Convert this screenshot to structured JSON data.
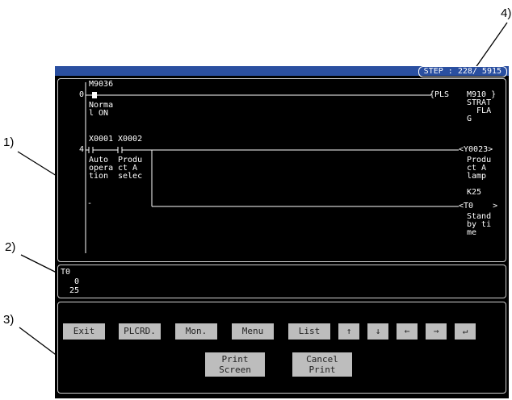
{
  "callouts": [
    "1)",
    "2)",
    "3)",
    "4)"
  ],
  "header": {
    "step": "STEP :  228/ 5915"
  },
  "ladder": {
    "rung0": {
      "step": "0",
      "contact": "M9036",
      "comment": "Norma\nl ON",
      "instr": "{PLS",
      "device": "M910 }",
      "dev_comment": "STRAT\n  FLA\nG"
    },
    "rung4": {
      "step": "4",
      "contact1": "X0001",
      "comment1": "Auto\nopera\ntion",
      "contact2": "X0002",
      "comment2": "Produ\nct A\nselec",
      "coil1": "<Y0023>",
      "coil1_comment": "Produ\nct A\nlamp",
      "timer_k": "K25",
      "coil2": "<T0    >",
      "coil2_comment": "Stand\nby ti\nme"
    },
    "cursor_mark": "-"
  },
  "monitor": {
    "device": "T0",
    "current": "0",
    "setting": "25"
  },
  "buttons": {
    "exit": "Exit",
    "plcrd": "PLCRD.",
    "mon": "Mon.",
    "menu": "Menu",
    "list": "List",
    "up": "↑",
    "down": "↓",
    "left": "←",
    "right": "→",
    "enter": "↵",
    "print_screen": "Print\nScreen",
    "cancel_print": "Cancel\nPrint"
  }
}
